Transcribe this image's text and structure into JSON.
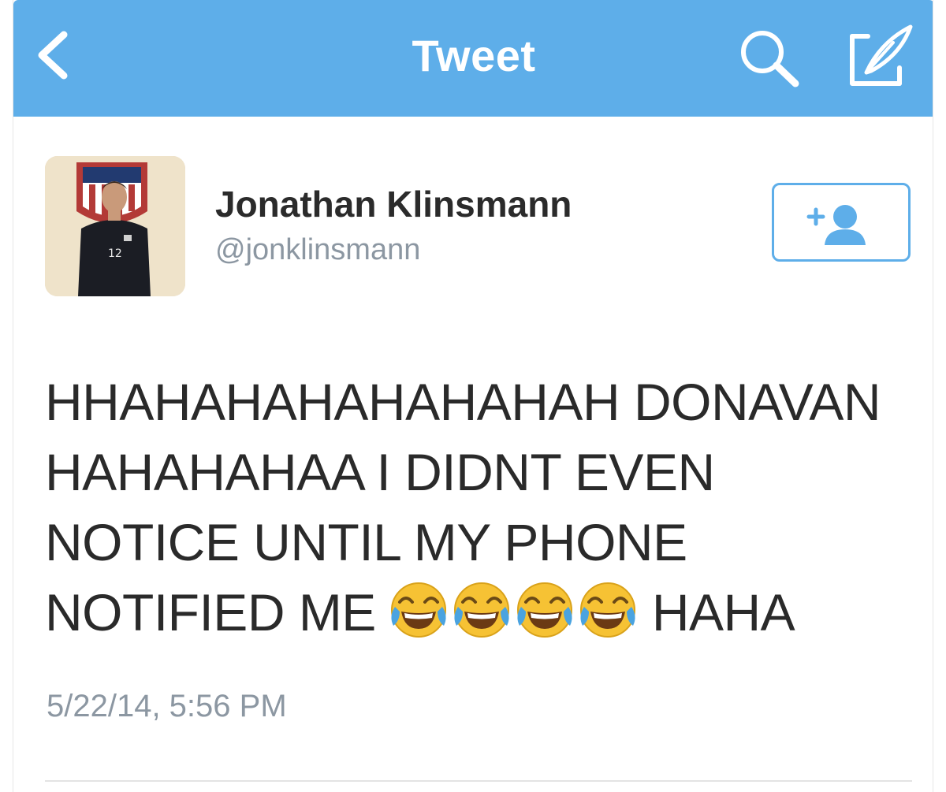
{
  "header": {
    "title": "Tweet",
    "back_icon": "chevron-left-icon",
    "search_icon": "search-icon",
    "compose_icon": "compose-icon",
    "bar_color": "#5eaee9"
  },
  "tweet": {
    "author_name": "Jonathan Klinsmann",
    "author_handle": "@jonklinsmann",
    "avatar_jersey_number": "12",
    "follow_icon": "add-user-icon",
    "text_lines": [
      "HHAHAHAHAHAHAHAH DONAVAN",
      "HAHAHAHAA I DIDNT EVEN",
      "NOTICE UNTIL MY PHONE",
      "NOTIFIED ME"
    ],
    "emoji": "face-with-tears-of-joy-icon",
    "emoji_count": 4,
    "text_tail": "HAHA",
    "timestamp": "5/22/14, 5:56 PM"
  }
}
